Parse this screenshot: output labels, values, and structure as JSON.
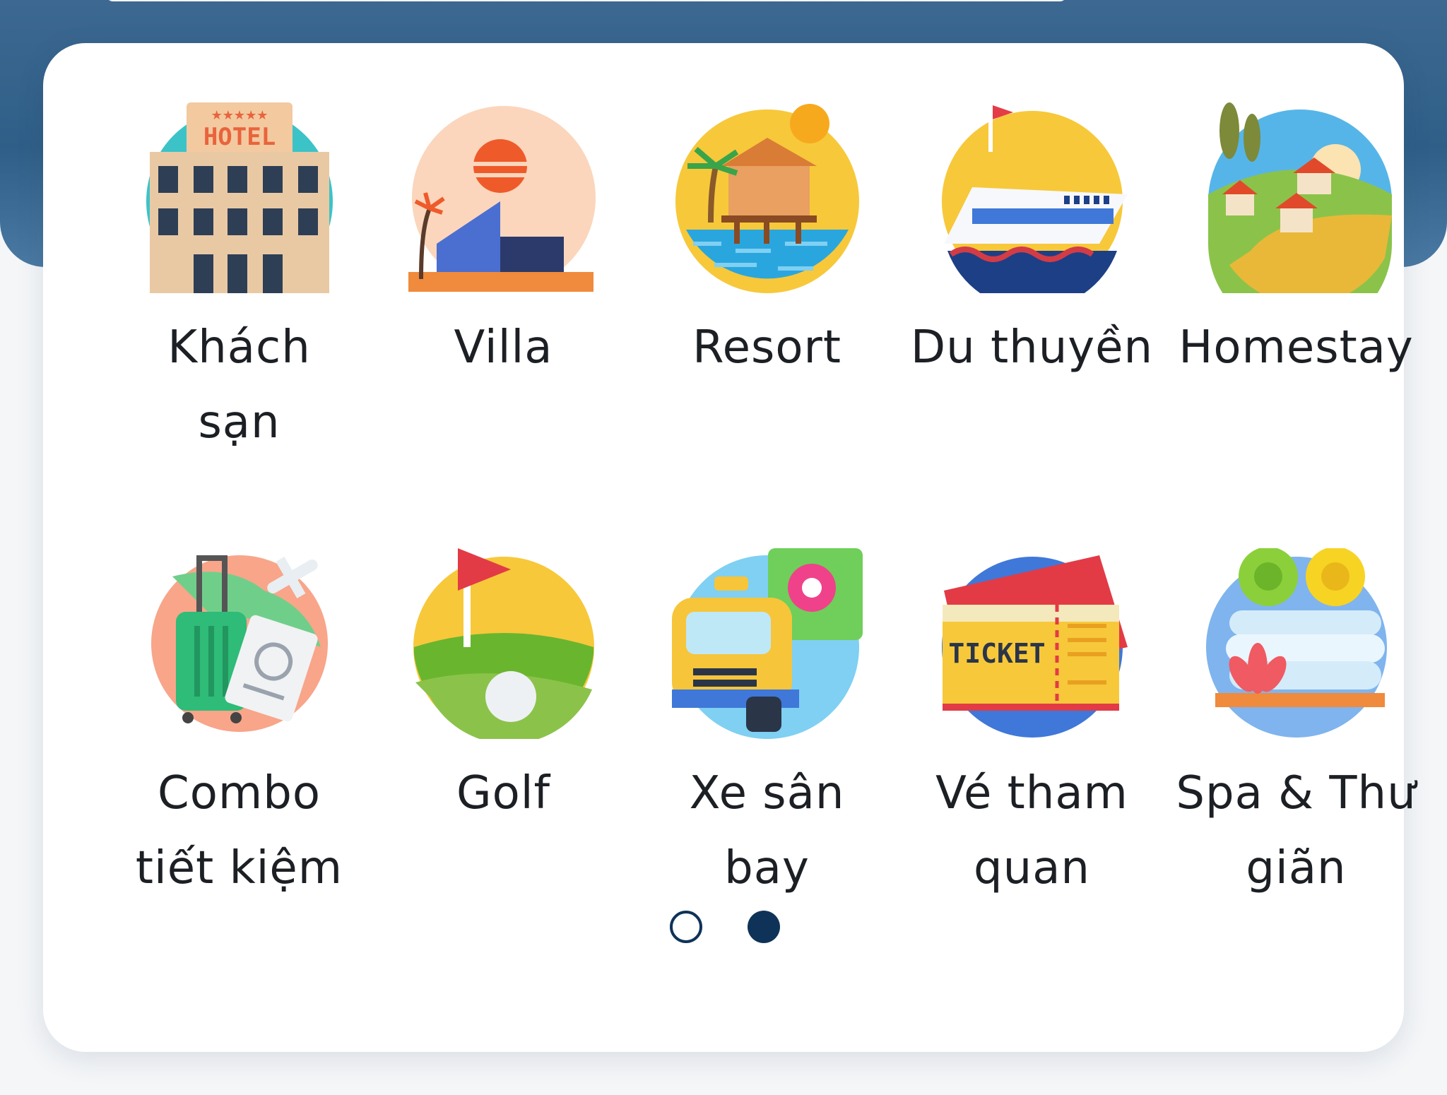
{
  "colors": {
    "banner": "#3c6891",
    "card": "#ffffff",
    "text": "#1c1f24",
    "pager_active": "#0f3358"
  },
  "categories": [
    {
      "label": "Khách\nsạn",
      "icon": "hotel-icon",
      "badge": "HOTEL"
    },
    {
      "label": "Villa",
      "icon": "villa-icon"
    },
    {
      "label": "Resort",
      "icon": "resort-icon"
    },
    {
      "label": "Du thuyền",
      "icon": "cruise-ship-icon"
    },
    {
      "label": "Homestay",
      "icon": "homestay-icon"
    },
    {
      "label": "Combo\ntiết kiệm",
      "icon": "travel-combo-icon"
    },
    {
      "label": "Golf",
      "icon": "golf-icon"
    },
    {
      "label": "Xe sân\nbay",
      "icon": "airport-taxi-icon"
    },
    {
      "label": "Vé tham\nquan",
      "icon": "ticket-icon",
      "badge": "TICKET"
    },
    {
      "label": "Spa & Thư\ngiãn",
      "icon": "spa-icon"
    }
  ],
  "pager": {
    "pages": 2,
    "current": 2
  }
}
